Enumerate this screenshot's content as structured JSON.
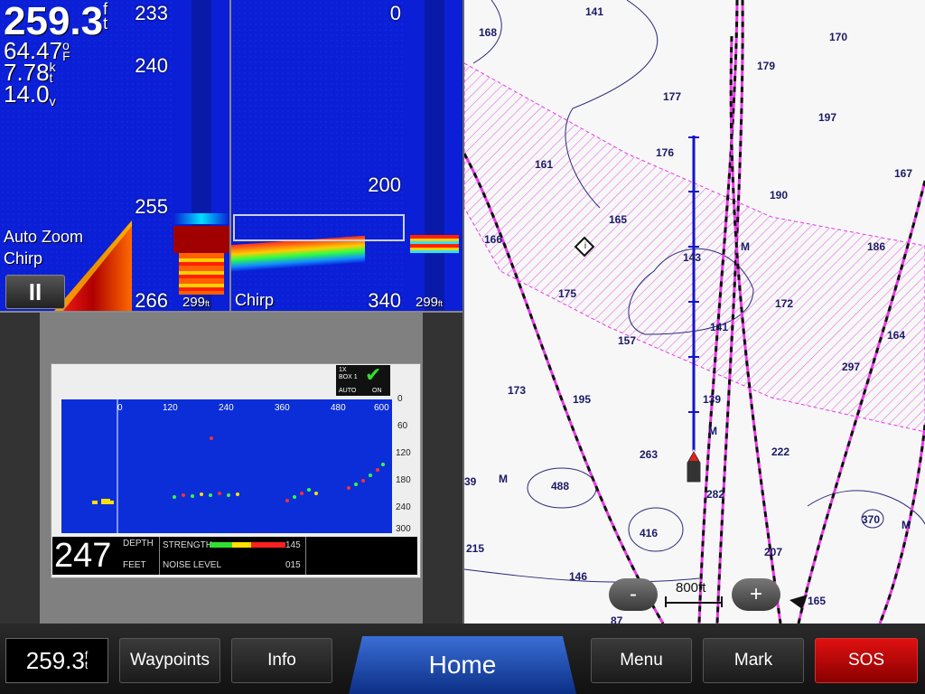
{
  "left_sonar": {
    "depth": "259.3",
    "depth_unit_top": "f",
    "depth_unit_bottom": "t",
    "water_temp": "64.47",
    "temp_unit_top": "o",
    "temp_unit_bottom": "F",
    "speed": "7.78",
    "speed_unit_top": "k",
    "speed_unit_bottom": "t",
    "voltage": "14.0",
    "voltage_unit": "v",
    "scale": [
      "233",
      "240",
      "255",
      "266"
    ],
    "zoom_label": "Auto Zoom",
    "mode_label": "Chirp",
    "pause_symbol": "II",
    "flasher_depth": "299",
    "flasher_unit": "ft"
  },
  "right_sonar": {
    "scale": [
      "0",
      "200",
      "340"
    ],
    "mode_label": "Chirp",
    "flasher_depth": "299",
    "flasher_unit": "ft"
  },
  "video_screen": {
    "range_ticks": [
      "0",
      "120",
      "240",
      "360",
      "480",
      "600"
    ],
    "depth_ticks": [
      "0",
      "60",
      "120",
      "180",
      "240",
      "300"
    ],
    "badge_top": "1X\nBOX 1",
    "badge_auto": "AUTO",
    "badge_on": "ON",
    "depth_value": "247",
    "depth_label": "DEPTH",
    "feet_label": "FEET",
    "strength_label": "STRENGTH",
    "strength_value": "145",
    "noise_label": "NOISE LEVEL",
    "noise_value": "015"
  },
  "map": {
    "soundings": [
      {
        "t": "141"
      },
      {
        "t": "168"
      },
      {
        "t": "170"
      },
      {
        "t": "179"
      },
      {
        "t": "177"
      },
      {
        "t": "197"
      },
      {
        "t": "176"
      },
      {
        "t": "161"
      },
      {
        "t": "167"
      },
      {
        "t": "190"
      },
      {
        "t": "165"
      },
      {
        "t": "166"
      },
      {
        "t": "186"
      },
      {
        "t": "143"
      },
      {
        "t": "175"
      },
      {
        "t": "172"
      },
      {
        "t": "141"
      },
      {
        "t": "157"
      },
      {
        "t": "164"
      },
      {
        "t": "297"
      },
      {
        "t": "173"
      },
      {
        "t": "195"
      },
      {
        "t": "139"
      },
      {
        "t": "222"
      },
      {
        "t": "263"
      },
      {
        "t": "39"
      },
      {
        "t": "488"
      },
      {
        "t": "282"
      },
      {
        "t": "370"
      },
      {
        "t": "416"
      },
      {
        "t": "215"
      },
      {
        "t": "207"
      },
      {
        "t": "146"
      },
      {
        "t": "165"
      },
      {
        "t": "87"
      }
    ],
    "m_marks": [
      "M",
      "M",
      "M",
      "M"
    ],
    "zoom_minus": "-",
    "zoom_plus": "+",
    "scale_label": "800ft",
    "colors": {
      "boundary": "#e838e8",
      "hatch": "#e070e0",
      "range_line": "#1515c8"
    }
  },
  "bottom_bar": {
    "depth": "259.3",
    "depth_unit_top": "f",
    "depth_unit_bottom": "t",
    "waypoints": "Waypoints",
    "info": "Info",
    "home": "Home",
    "menu": "Menu",
    "mark": "Mark",
    "sos": "SOS"
  }
}
